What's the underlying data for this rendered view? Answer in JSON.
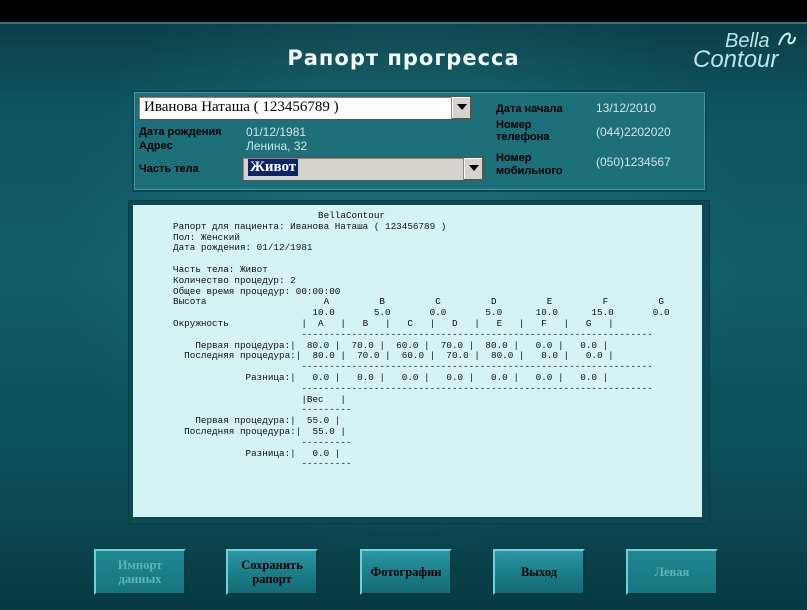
{
  "header": {
    "title": "Рапорт прогресса",
    "logo_text_1": "Bella",
    "logo_text_2": "Contour"
  },
  "patient": {
    "selected": "Иванова Наташа ( 123456789 )",
    "dob_label": "Дата рождения",
    "dob": "01/12/1981",
    "address_label": "Адрес",
    "address": "Ленина, 32",
    "bodypart_label": "Часть тела",
    "bodypart": "Живот",
    "start_label": "Дата начала",
    "start": "13/12/2010",
    "phone_label_1": "Номер",
    "phone_label_2": "телефона",
    "phone": "(044)2202020",
    "mobile_label_1": "Номер",
    "mobile_label_2": "мобильного",
    "mobile": "(050)1234567"
  },
  "report": {
    "text": "                          BellaContour\nРапорт для пациента: Иванова Наташа ( 123456789 )\nПол: Женский\nДата рождения: 01/12/1981\n\nЧасть тела: Живот\nКоличество процедур: 2\nОбщее время процедур: 00:00:00\nВысота                     A         B         C         D         E         F         G\n                         10.0       5.0       0.0       5.0      10.0      15.0       0.0\nОкружность             |  A   |   B   |   C   |   D   |   E   |   F   |   G   |\n                       ---------------------------------------------------------------\n    Первая процедура:|  80.0 |  70.0 |  60.0 |  70.0 |  80.0 |   0.0 |   0.0 |\n  Последняя процедура:|  80.0 |  70.0 |  60.0 |  70.0 |  80.0 |   0.0 |   0.0 |\n                       ---------------------------------------------------------------\n             Разница:|   0.0 |   0.0 |   0.0 |   0.0 |   0.0 |   0.0 |   0.0 |\n                       ---------------------------------------------------------------\n                       |Вес   |\n                       ---------\n    Первая процедура:|  55.0 |\n  Последняя процедура:|  55.0 |\n                       ---------\n             Разница:|   0.0 |\n                       ---------"
  },
  "buttons": {
    "import_1": "Импорт",
    "import_2": "данных",
    "save_1": "Сохранить",
    "save_2": "рапорт",
    "photos": "Фотографии",
    "exit": "Выход",
    "left": "Левая"
  }
}
